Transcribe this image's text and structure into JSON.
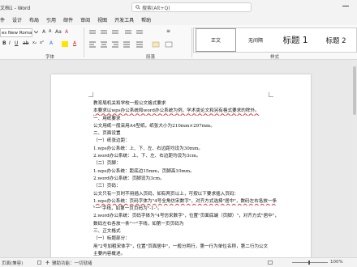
{
  "window": {
    "title": "文档1 - Word"
  },
  "search": {
    "placeholder": "搜索(Alt+Q)"
  },
  "menu": {
    "tabs": [
      "件",
      "设计",
      "布局",
      "引用",
      "邮件",
      "审阅",
      "视图",
      "开发工具",
      "帮助"
    ]
  },
  "ribbon": {
    "font_name": "es New Roman",
    "font_row2": "Aa",
    "clear_format": "A",
    "para_row2": "≡",
    "group_labels": {
      "font": "字体",
      "paragraph": "段落",
      "styles": "样式"
    },
    "styles": [
      "正文",
      "无间隔",
      "标题 1",
      "标题 2"
    ]
  },
  "document": {
    "lines": [
      "教育局机关和学校一般公文格式要求",
      "本要求以wps办公系统和word办公系统为例，学术类论文和另有格式要求的除外。",
      "一、用纸要求",
      "公文用纸一般采用A4型纸，纸张大小为210mm×297mm。",
      "二、页面设置",
      "（一）纸张边距：",
      "1.wps办公系统：上、下、左、右边距均设为30mm。",
      "2.word办公系统：上、下、左、右边距均设为3cm。",
      "（二）页脚：",
      "1.wps办公系统：距底边15mm，页脚高10mm。",
      "2.word办公系统：页脚设为3cm。",
      "（三）页码：",
      "公文只有一页时不用插入页码，如有两页以上，可按以下要求插入页码：",
      "1.wps办公系统：页码字体为\"4号全角仿宋数字\"，对齐方式选择\"居中\"，数码左右各放一条",
      "\"一\"字线，如第一页页码为\"-1-\"。",
      "2.word办公系统：页码字体为\"4号仿宋数字\"，位置\"页面底端（页脚）\"，对齐方式\"居中\"，",
      "数码左右各放一条\"一\"字线，如第一页页码为",
      "三、正文格式",
      "（一）标题部分：",
      "用\"2号加粗宋体字\"，位置\"页面居中\"，一般分两行，第一行为单位名称，第二行为公文",
      "主要内容概述。"
    ]
  },
  "statusbar": {
    "page": "页面(兼容)",
    "accessibility": "辅助功能：一切就绪",
    "zoom": "100%"
  }
}
